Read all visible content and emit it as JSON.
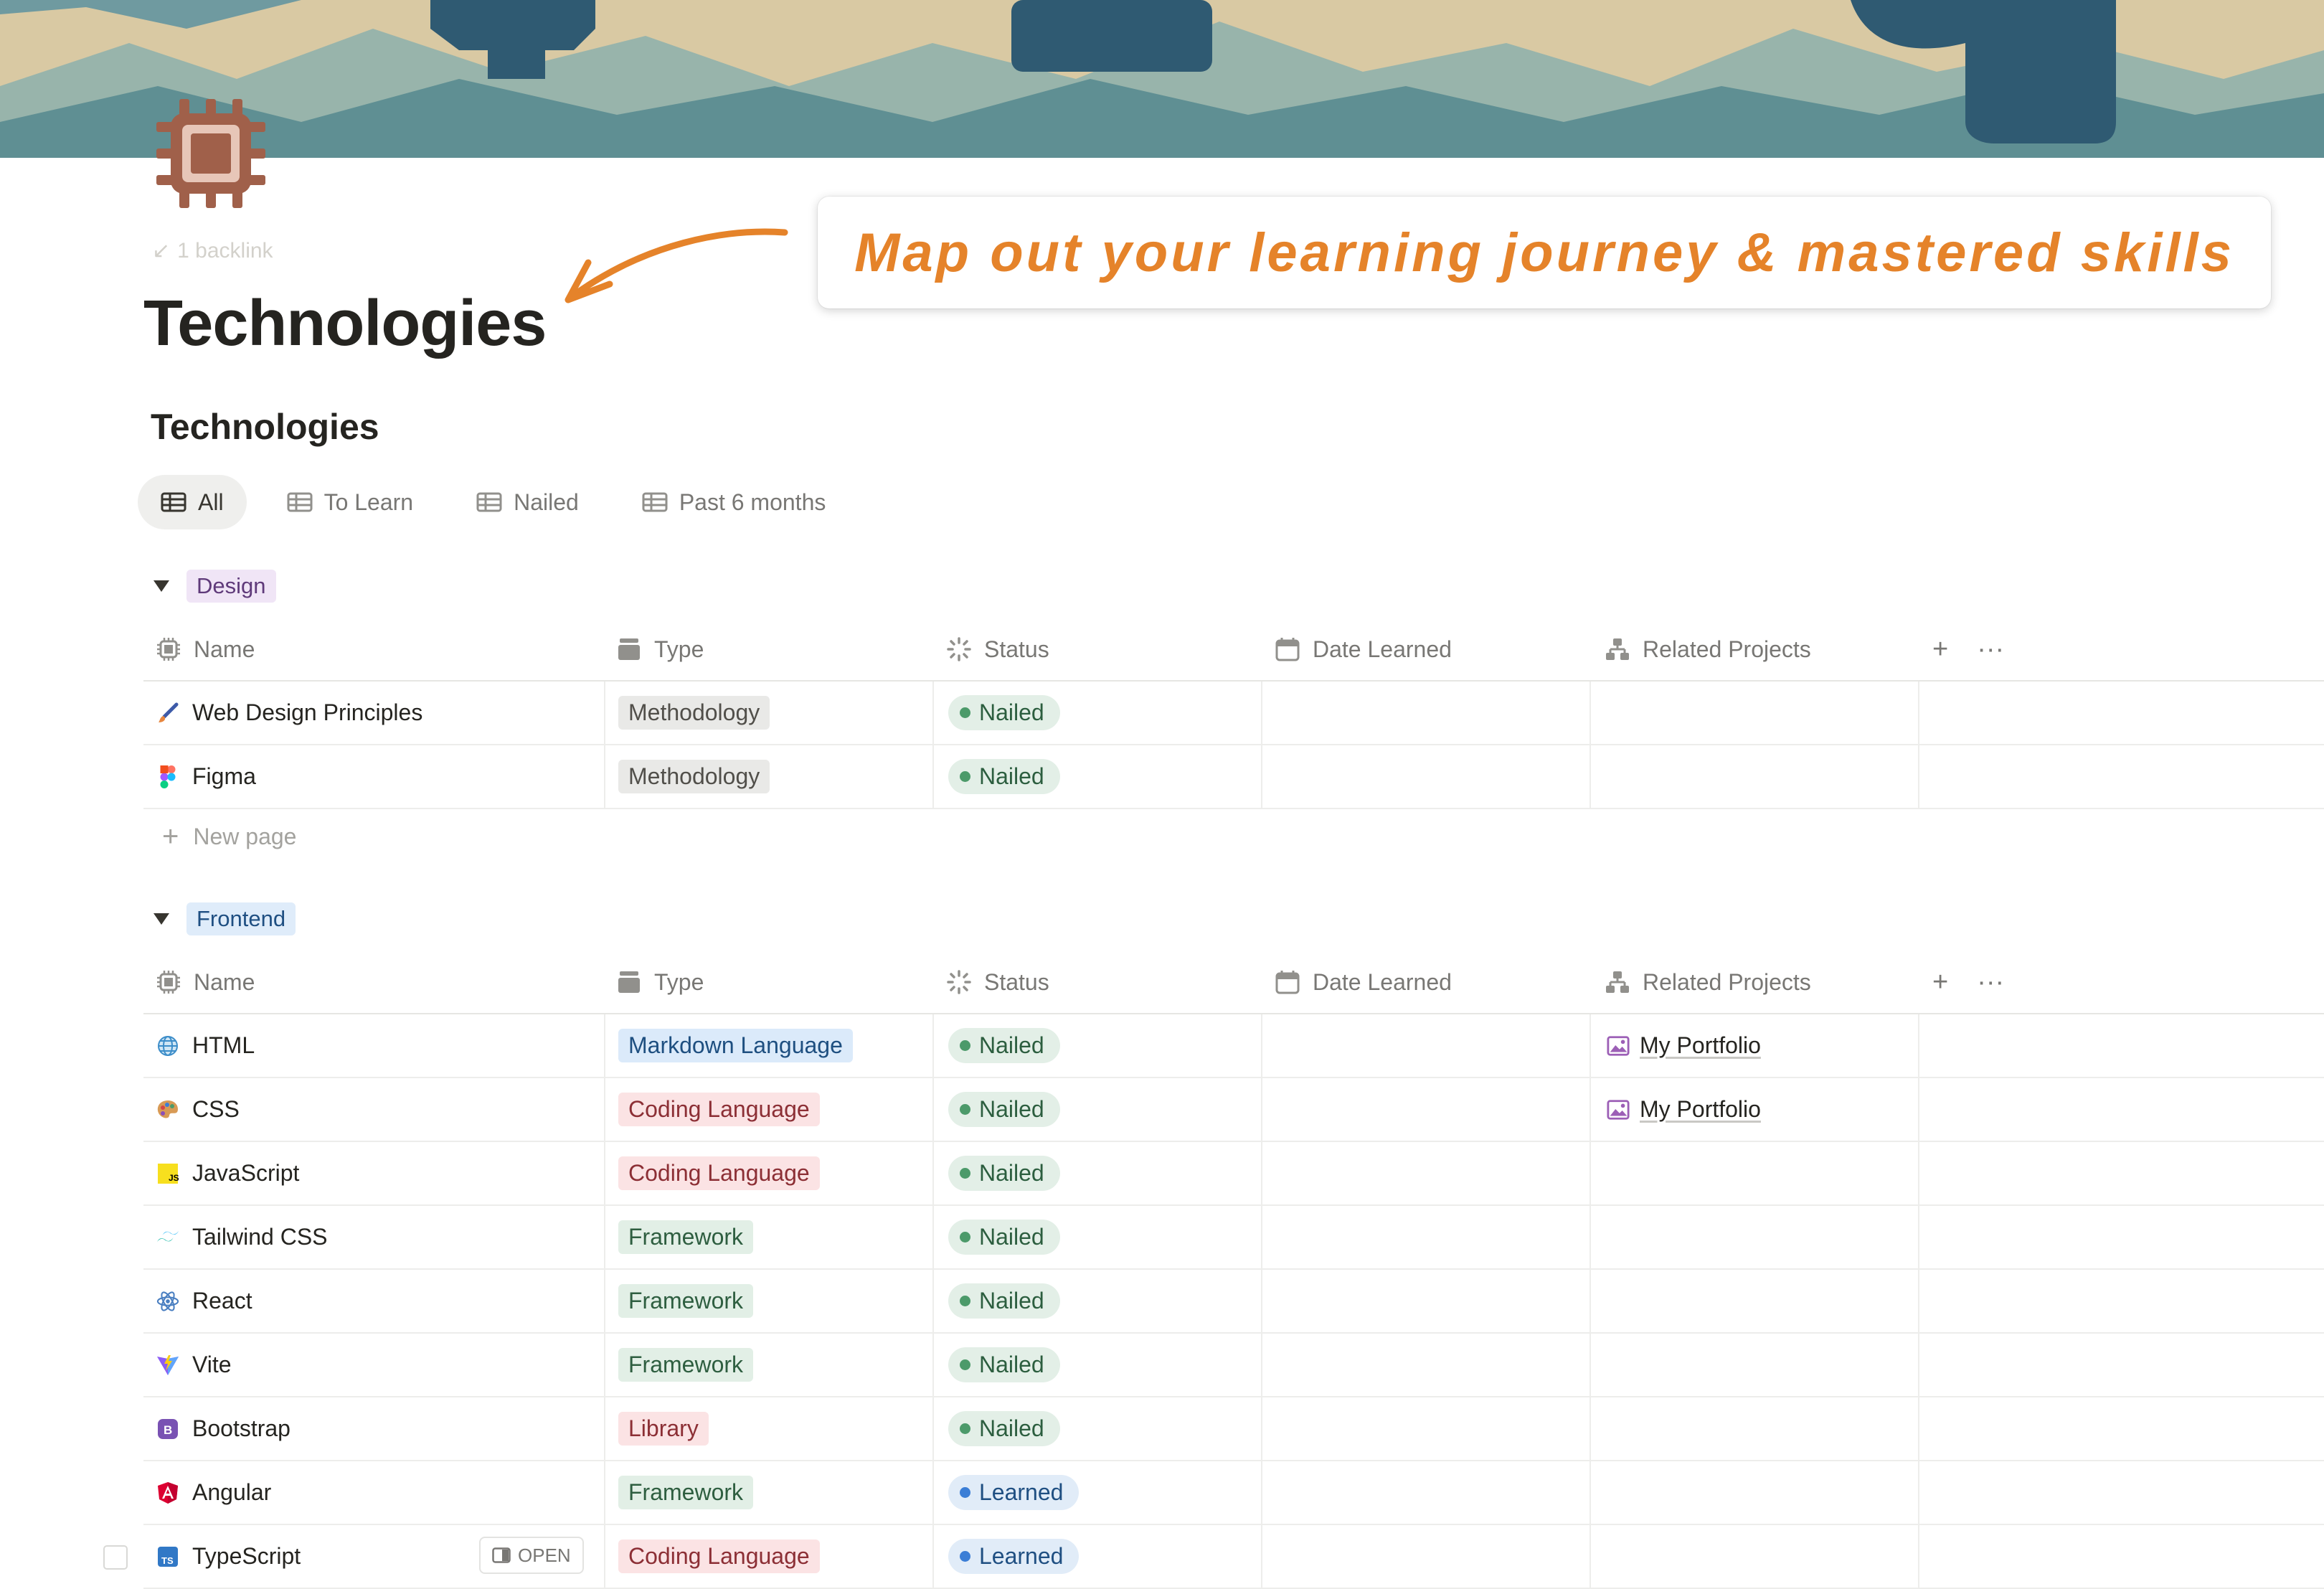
{
  "backlink": "1 backlink",
  "page_title": "Technologies",
  "callout": "Map out your learning journey & mastered skills",
  "database": {
    "title": "Technologies",
    "views": [
      {
        "label": "All",
        "active": true
      },
      {
        "label": "To Learn",
        "active": false
      },
      {
        "label": "Nailed",
        "active": false
      },
      {
        "label": "Past 6 months",
        "active": false
      }
    ],
    "columns": {
      "name": "Name",
      "type": "Type",
      "status": "Status",
      "date": "Date Learned",
      "projects": "Related Projects",
      "add": "+",
      "more": "···"
    },
    "new_page": "New page",
    "open_label": "OPEN"
  },
  "groups": [
    {
      "label": "Design",
      "rows": [
        {
          "name": "Web Design Principles",
          "icon": "paintbrush-icon",
          "type": "Methodology",
          "status": "Nailed",
          "date": "",
          "project": ""
        },
        {
          "name": "Figma",
          "icon": "figma-icon",
          "type": "Methodology",
          "status": "Nailed",
          "date": "",
          "project": ""
        }
      ]
    },
    {
      "label": "Frontend",
      "rows": [
        {
          "name": "HTML",
          "icon": "globe-icon",
          "type": "Markdown Language",
          "status": "Nailed",
          "date": "",
          "project": "My Portfolio"
        },
        {
          "name": "CSS",
          "icon": "palette-icon",
          "type": "Coding Language",
          "status": "Nailed",
          "date": "",
          "project": "My Portfolio"
        },
        {
          "name": "JavaScript",
          "icon": "javascript-icon",
          "type": "Coding Language",
          "status": "Nailed",
          "date": "",
          "project": ""
        },
        {
          "name": "Tailwind CSS",
          "icon": "tailwind-icon",
          "type": "Framework",
          "status": "Nailed",
          "date": "",
          "project": ""
        },
        {
          "name": "React",
          "icon": "react-icon",
          "type": "Framework",
          "status": "Nailed",
          "date": "",
          "project": ""
        },
        {
          "name": "Vite",
          "icon": "vite-icon",
          "type": "Framework",
          "status": "Nailed",
          "date": "",
          "project": ""
        },
        {
          "name": "Bootstrap",
          "icon": "bootstrap-icon",
          "type": "Library",
          "status": "Nailed",
          "date": "",
          "project": ""
        },
        {
          "name": "Angular",
          "icon": "angular-icon",
          "type": "Framework",
          "status": "Learned",
          "date": "",
          "project": ""
        },
        {
          "name": "TypeScript",
          "icon": "typescript-icon",
          "type": "Coding Language",
          "status": "Learned",
          "date": "",
          "project": ""
        }
      ]
    }
  ],
  "colors": {
    "accent_orange": "#e5832a",
    "design_tag_bg": "#f0e5f6",
    "design_tag_text": "#5f3a7a",
    "frontend_tag_bg": "#dfecfa",
    "frontend_tag_text": "#1f4f82",
    "nailed_bg": "#e3efe7",
    "nailed_dot": "#4c9a6a",
    "learned_bg": "#e1ecf8",
    "learned_dot": "#3b7ed6"
  }
}
